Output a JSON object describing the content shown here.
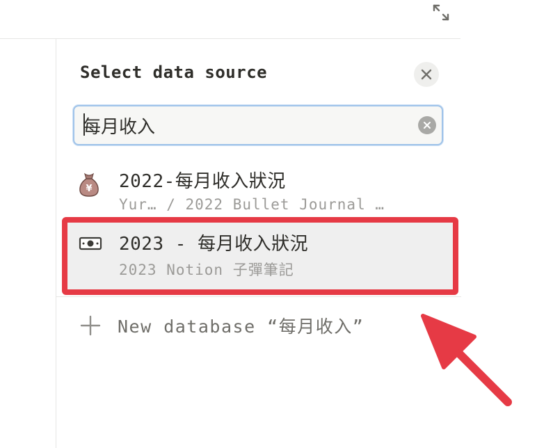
{
  "header": {
    "expand_icon": "expand-arrows-icon"
  },
  "picker": {
    "title": "Select data source",
    "close_icon": "close-icon",
    "search": {
      "value": "每月收入",
      "placeholder": "",
      "clear_icon": "clear-circle-icon"
    },
    "results": [
      {
        "icon": "money-bag-icon",
        "title": "2022-每月收入狀況",
        "subtitle": "Yur… / 2022 Bullet Journal …"
      },
      {
        "icon": "dollar-banknote-icon",
        "title": "2023 - 每月收入狀況",
        "subtitle": "2023 Notion 子彈筆記",
        "highlighted": true
      }
    ],
    "new_database": {
      "icon": "plus-icon",
      "label": "New database “每月收入”"
    }
  },
  "annotation": {
    "arrow_color": "#e63a45",
    "highlight_color": "#e63a45"
  }
}
